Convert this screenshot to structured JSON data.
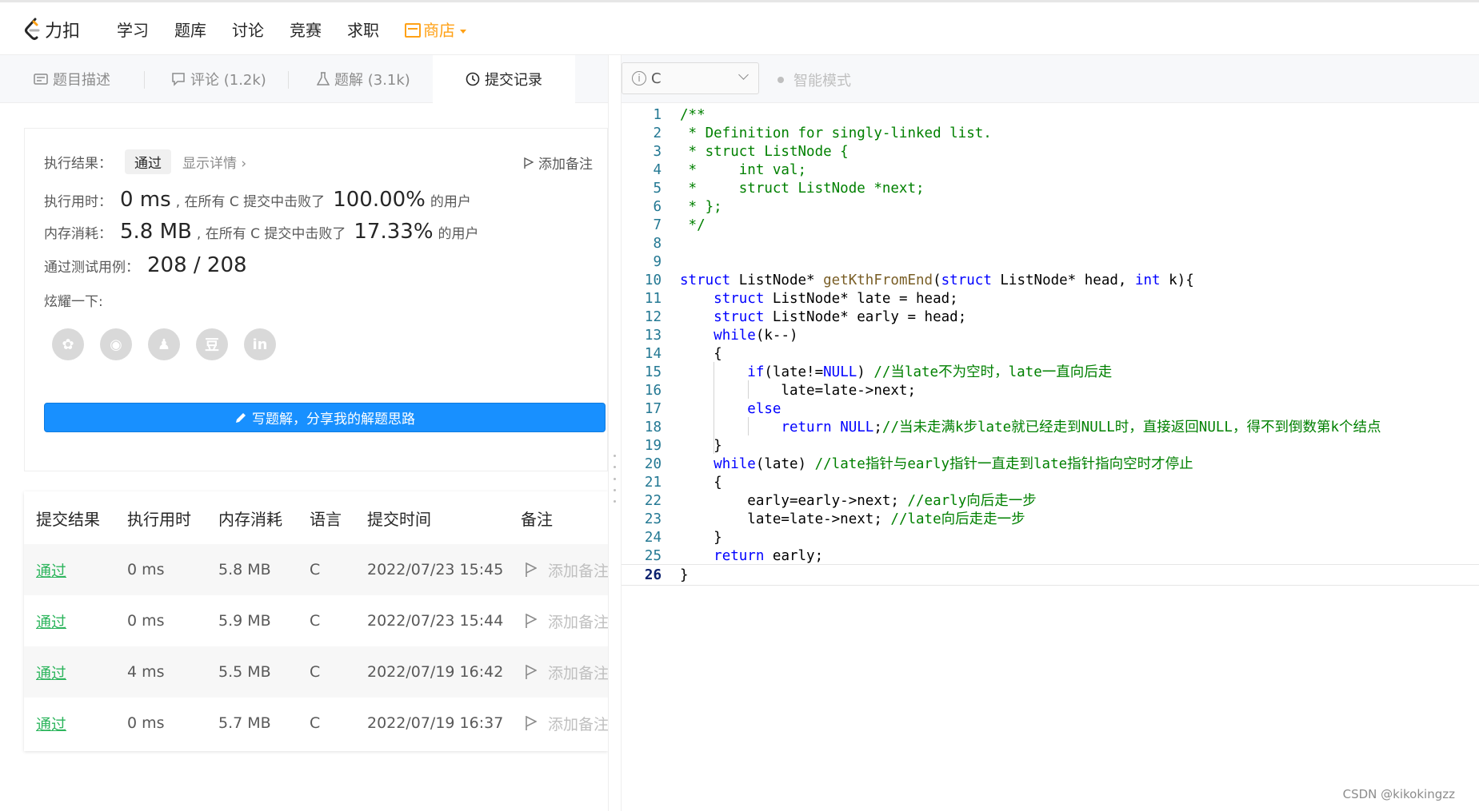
{
  "nav": {
    "logo_text": "力扣",
    "items": [
      "学习",
      "题库",
      "讨论",
      "竞赛",
      "求职"
    ],
    "shop": "商店"
  },
  "tabs": [
    {
      "label": "题目描述",
      "icon": "description-icon"
    },
    {
      "label": "评论 (1.2k)",
      "icon": "comment-icon"
    },
    {
      "label": "题解 (3.1k)",
      "icon": "flask-icon"
    },
    {
      "label": "提交记录",
      "icon": "clock-icon"
    }
  ],
  "result": {
    "status_label": "执行结果：",
    "status": "通过",
    "detail": "显示详情 ›",
    "add_note": "添加备注",
    "runtime_label": "执行用时：",
    "runtime": "0 ms",
    "runtime_beat": ", 在所有 C 提交中击败了",
    "runtime_pct": "100.00%",
    "runtime_suffix": "的用户",
    "memory_label": "内存消耗：",
    "memory": "5.8 MB",
    "memory_beat": ", 在所有 C 提交中击败了",
    "memory_pct": "17.33%",
    "memory_suffix": "的用户",
    "cases_label": "通过测试用例：",
    "cases": "208 / 208",
    "share_label": "炫耀一下:",
    "share_icons": [
      "wechat-icon",
      "weibo-icon",
      "qq-icon",
      "douban-icon",
      "linkedin-icon"
    ],
    "share_glyphs": [
      "✿",
      "◉",
      "♟",
      "豆",
      "in"
    ],
    "write_button": "写题解，分享我的解题思路"
  },
  "table": {
    "headers": [
      "提交结果",
      "执行用时",
      "内存消耗",
      "语言",
      "提交时间",
      "备注"
    ],
    "rows": [
      {
        "result": "通过",
        "time": "0 ms",
        "memory": "5.8 MB",
        "lang": "C",
        "submitted": "2022/07/23 15:45",
        "note": "添加备注"
      },
      {
        "result": "通过",
        "time": "0 ms",
        "memory": "5.9 MB",
        "lang": "C",
        "submitted": "2022/07/23 15:44",
        "note": "添加备注"
      },
      {
        "result": "通过",
        "time": "4 ms",
        "memory": "5.5 MB",
        "lang": "C",
        "submitted": "2022/07/19 16:42",
        "note": "添加备注"
      },
      {
        "result": "通过",
        "time": "0 ms",
        "memory": "5.7 MB",
        "lang": "C",
        "submitted": "2022/07/19 16:37",
        "note": "添加备注"
      }
    ]
  },
  "editor": {
    "language": "C",
    "mode": "智能模式",
    "lines": [
      [
        [
          "c",
          "/**"
        ]
      ],
      [
        [
          "c",
          " * Definition for singly-linked list."
        ]
      ],
      [
        [
          "c",
          " * struct ListNode {"
        ]
      ],
      [
        [
          "c",
          " *     int val;"
        ]
      ],
      [
        [
          "c",
          " *     struct ListNode *next;"
        ]
      ],
      [
        [
          "c",
          " * };"
        ]
      ],
      [
        [
          "c",
          " */"
        ]
      ],
      [],
      [],
      [
        [
          "k",
          "struct"
        ],
        [
          "",
          " ListNode* "
        ],
        [
          "fn",
          "getKthFromEnd"
        ],
        [
          "",
          "("
        ],
        [
          "k",
          "struct"
        ],
        [
          "",
          " ListNode* head, "
        ],
        [
          "k",
          "int"
        ],
        [
          "",
          " k){"
        ]
      ],
      [
        [
          "",
          "    "
        ],
        [
          "k",
          "struct"
        ],
        [
          "",
          " ListNode* late = head;"
        ]
      ],
      [
        [
          "",
          "    "
        ],
        [
          "k",
          "struct"
        ],
        [
          "",
          " ListNode* early = head;"
        ]
      ],
      [
        [
          "",
          "    "
        ],
        [
          "k",
          "while"
        ],
        [
          "",
          "(k--)"
        ]
      ],
      [
        [
          "",
          "    {"
        ]
      ],
      [
        [
          "",
          "        "
        ],
        [
          "k",
          "if"
        ],
        [
          "",
          "(late!="
        ],
        [
          "k",
          "NULL"
        ],
        [
          "",
          ") "
        ],
        [
          "c",
          "//当late不为空时，late一直向后走"
        ]
      ],
      [
        [
          "",
          "            late=late->next;"
        ]
      ],
      [
        [
          "",
          "        "
        ],
        [
          "k",
          "else"
        ]
      ],
      [
        [
          "",
          "            "
        ],
        [
          "k",
          "return"
        ],
        [
          "",
          " "
        ],
        [
          "k",
          "NULL"
        ],
        [
          "",
          ";"
        ],
        [
          "c",
          "//当未走满k步late就已经走到NULL时，直接返回NULL，得不到倒数第k个结点"
        ]
      ],
      [
        [
          "",
          "    }"
        ]
      ],
      [
        [
          "",
          "    "
        ],
        [
          "k",
          "while"
        ],
        [
          "",
          "(late) "
        ],
        [
          "c",
          "//late指针与early指针一直走到late指针指向空时才停止"
        ]
      ],
      [
        [
          "",
          "    {"
        ]
      ],
      [
        [
          "",
          "        early=early->next; "
        ],
        [
          "c",
          "//early向后走一步"
        ]
      ],
      [
        [
          "",
          "        late=late->next; "
        ],
        [
          "c",
          "//late向后走走一步"
        ]
      ],
      [
        [
          "",
          "    }"
        ]
      ],
      [
        [
          "",
          "    "
        ],
        [
          "k",
          "return"
        ],
        [
          "",
          " early;"
        ]
      ],
      [
        [
          "",
          "}"
        ]
      ]
    ]
  },
  "watermark": "CSDN @kikokingzz"
}
